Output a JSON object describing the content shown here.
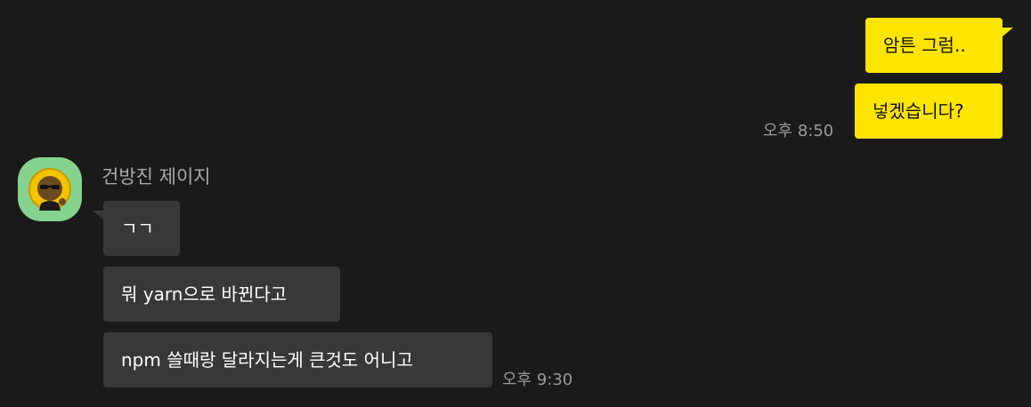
{
  "chat": {
    "outgoing": [
      {
        "text": "암튼 그럼.."
      },
      {
        "text": "넣겠습니다?"
      }
    ],
    "outgoing_time": "오후 8:50",
    "incoming": {
      "sender_name": "건방진 제이지",
      "avatar_icon": "character-avatar-icon",
      "messages": [
        {
          "text": "ㄱㄱ"
        },
        {
          "text": "뭐 yarn으로 바뀐다고"
        },
        {
          "text": "npm 쓸때랑 달라지는게 큰것도 어니고"
        }
      ],
      "time": "오후 9:30"
    }
  },
  "colors": {
    "background": "#1a1a1a",
    "outgoing_bubble": "#fee500",
    "incoming_bubble": "#383838",
    "timestamp": "#9a9a9a",
    "sender_name": "#a8a8a8",
    "avatar_bg": "#86d38f"
  }
}
